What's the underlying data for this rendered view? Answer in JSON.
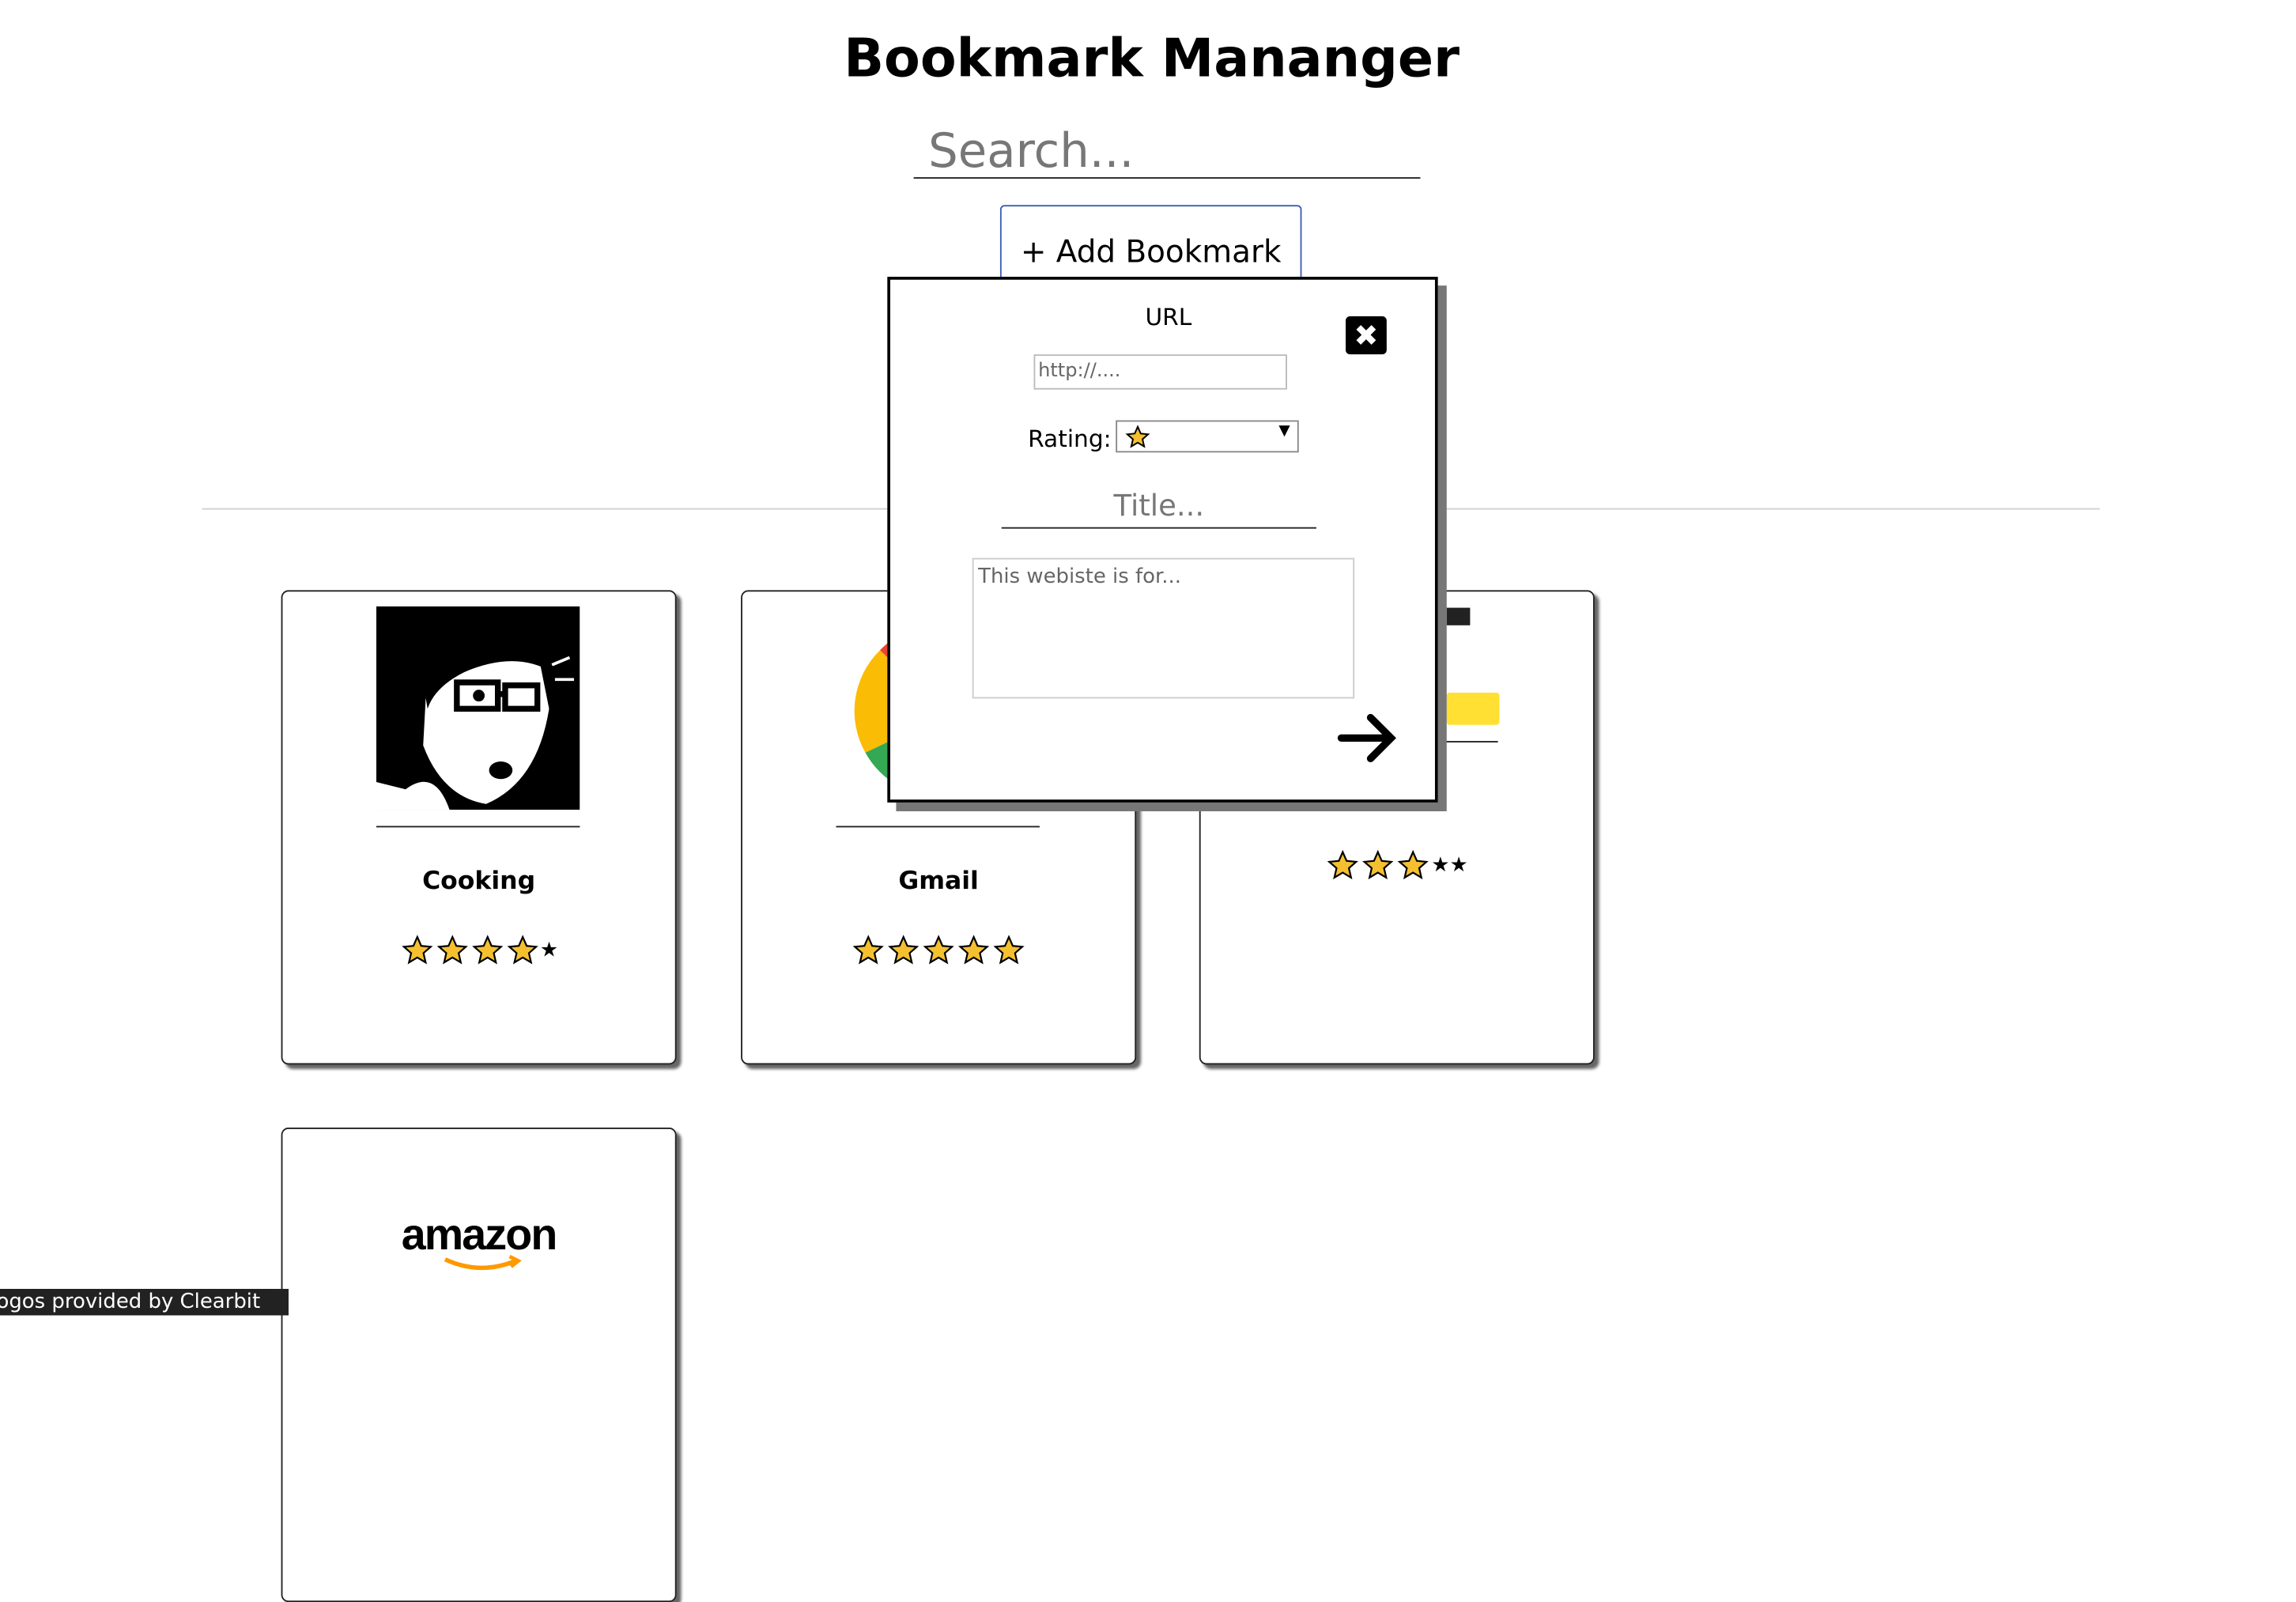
{
  "app": {
    "title": "Bookmark Mananger"
  },
  "search": {
    "placeholder": "Search..."
  },
  "toolbar": {
    "add_label": "+ Add Bookmark"
  },
  "bookmarks": [
    {
      "title": "Cooking",
      "rating": 4,
      "logo": "comic-avatar"
    },
    {
      "title": "Gmail",
      "rating": 5,
      "logo": "google-logo"
    },
    {
      "title": "",
      "rating": 3,
      "logo": "tag-logo"
    },
    {
      "title": "",
      "rating": null,
      "logo": "amazon-logo",
      "logo_text": "amazon"
    }
  ],
  "modal": {
    "url_label": "URL",
    "url_placeholder": "http://....",
    "rating_label": "Rating:",
    "rating_value": 1,
    "title_placeholder": "Title...",
    "description_placeholder": "This webiste is for..."
  },
  "footer": {
    "credit": "Logos provided by Clearbit"
  },
  "colors": {
    "star": "#f5c030",
    "button_border": "#3b5fb0"
  }
}
